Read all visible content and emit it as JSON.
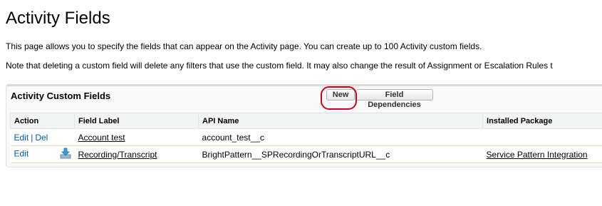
{
  "page": {
    "title": "Activity Fields",
    "intro_1": "This page allows you to specify the fields that can appear on the Activity page. You can create up to 100 Activity custom fields.",
    "intro_2": "Note that deleting a custom field will delete any filters that use the custom field. It may also change the result of Assignment or Escalation Rules t"
  },
  "panel": {
    "title": "Activity Custom Fields",
    "new_button": "New",
    "dependencies_button": "Field Dependencies"
  },
  "table": {
    "headers": {
      "action": "Action",
      "label": "Field Label",
      "api": "API Name",
      "package": "Installed Package"
    },
    "rows": [
      {
        "edit": "Edit",
        "sep": "|",
        "del": "Del",
        "label": "Account test",
        "api": "account_test__c",
        "package": ""
      },
      {
        "edit": "Edit",
        "icon": "download-icon",
        "label": "Recording/Transcript",
        "api": "BrightPattern__SPRecordingOrTranscriptURL__c",
        "package": "Service Pattern Integration"
      }
    ]
  },
  "colors": {
    "link": "#015ba7",
    "highlight": "#d0021b"
  }
}
